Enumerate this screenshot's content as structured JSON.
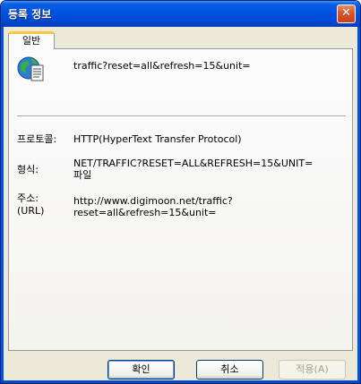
{
  "window": {
    "title": "등록 정보",
    "close_glyph": "✕"
  },
  "tabs": [
    {
      "label": "일반",
      "active": true
    }
  ],
  "general": {
    "icon": "web-page-icon",
    "item_name": "traffic?reset=all&refresh=15&unit=",
    "fields": {
      "protocol_label": "프로토콜:",
      "protocol_value": "HTTP(HyperText Transfer Protocol)",
      "type_label": "형식:",
      "type_value_line1": "NET/TRAFFIC?RESET=ALL&REFRESH=15&UNIT=",
      "type_value_line2": "파일",
      "address_label_line1": "주소:",
      "address_label_line2": "(URL)",
      "address_value_line1": "http://www.digimoon.net/traffic?",
      "address_value_line2": "reset=all&refresh=15&unit="
    }
  },
  "buttons": {
    "ok": "확인",
    "cancel": "취소",
    "apply": "적용(A)"
  }
}
